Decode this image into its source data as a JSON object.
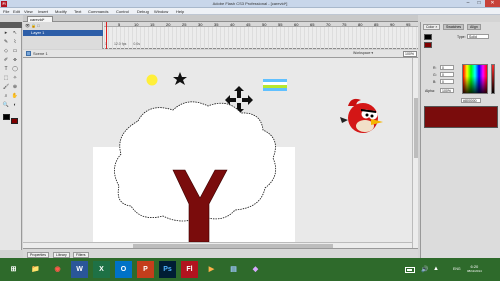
{
  "window": {
    "title": "Adobe Flash CS3 Professional - [carevid*]",
    "app_badge": "Fl",
    "min_glyph": "–",
    "max_glyph": "□",
    "close_glyph": "✕"
  },
  "menu": [
    "File",
    "Edit",
    "View",
    "Insert",
    "Modify",
    "Text",
    "Commands",
    "Control",
    "Debug",
    "Window",
    "Help"
  ],
  "document_tab": "carevid*",
  "timeline": {
    "layer_name": "Layer 1",
    "frame_numbers": [
      "5",
      "10",
      "15",
      "20",
      "25",
      "30",
      "35",
      "40",
      "45",
      "50",
      "55",
      "60",
      "65",
      "70",
      "75",
      "80",
      "85",
      "90",
      "95"
    ],
    "status_frame": "1",
    "status_fps": "12.0 fps",
    "status_time": "0.0s"
  },
  "editbar": {
    "scene": "Scene 1",
    "workspace": "Workspace ▾",
    "zoom": "100%"
  },
  "bottom_tabs": [
    "Properties",
    "Library",
    "Filters"
  ],
  "right_panel": {
    "tabs": [
      "Color ×",
      "Swatches",
      "Align"
    ],
    "type_label": "Type:",
    "type_value": "Solid",
    "r_label": "R:",
    "r_value": "0",
    "g_label": "G:",
    "g_value": "0",
    "b_label": "B:",
    "b_value": "0",
    "alpha_label": "Alpha:",
    "alpha_value": "100%",
    "hex": "#800000",
    "stroke_color": "#000000",
    "fill_color": "#800000"
  },
  "tools": [
    "▸",
    "↖",
    "✎",
    "⌇",
    "◇",
    "▭",
    "✐",
    "⌯",
    "T",
    "◯",
    "⬚",
    "✧",
    "🖌",
    "⊕",
    "⌕",
    "✋",
    "🔍",
    "◐"
  ],
  "taskbar": {
    "apps": [
      {
        "name": "start",
        "glyph": "⊞",
        "color": "#2e6a2b"
      },
      {
        "name": "explorer",
        "glyph": "📁",
        "color": "#d9a63a"
      },
      {
        "name": "chrome",
        "glyph": "◉",
        "color": "#cf3b30"
      },
      {
        "name": "word",
        "glyph": "W",
        "color": "#2a5699"
      },
      {
        "name": "excel",
        "glyph": "X",
        "color": "#1e7145"
      },
      {
        "name": "outlook",
        "glyph": "O",
        "color": "#0072c6"
      },
      {
        "name": "powerpoint",
        "glyph": "P",
        "color": "#c43e1c"
      },
      {
        "name": "photoshop",
        "glyph": "Ps",
        "color": "#001d34"
      },
      {
        "name": "flash",
        "glyph": "Fl",
        "color": "#b2131f"
      },
      {
        "name": "media",
        "glyph": "▶",
        "color": "#e36c0a"
      },
      {
        "name": "files",
        "glyph": "▤",
        "color": "#3a6aa8"
      },
      {
        "name": "app",
        "glyph": "◆",
        "color": "#7a3fb0"
      }
    ],
    "language": "ENG",
    "time": "6:20",
    "date": "08/11/2014"
  }
}
